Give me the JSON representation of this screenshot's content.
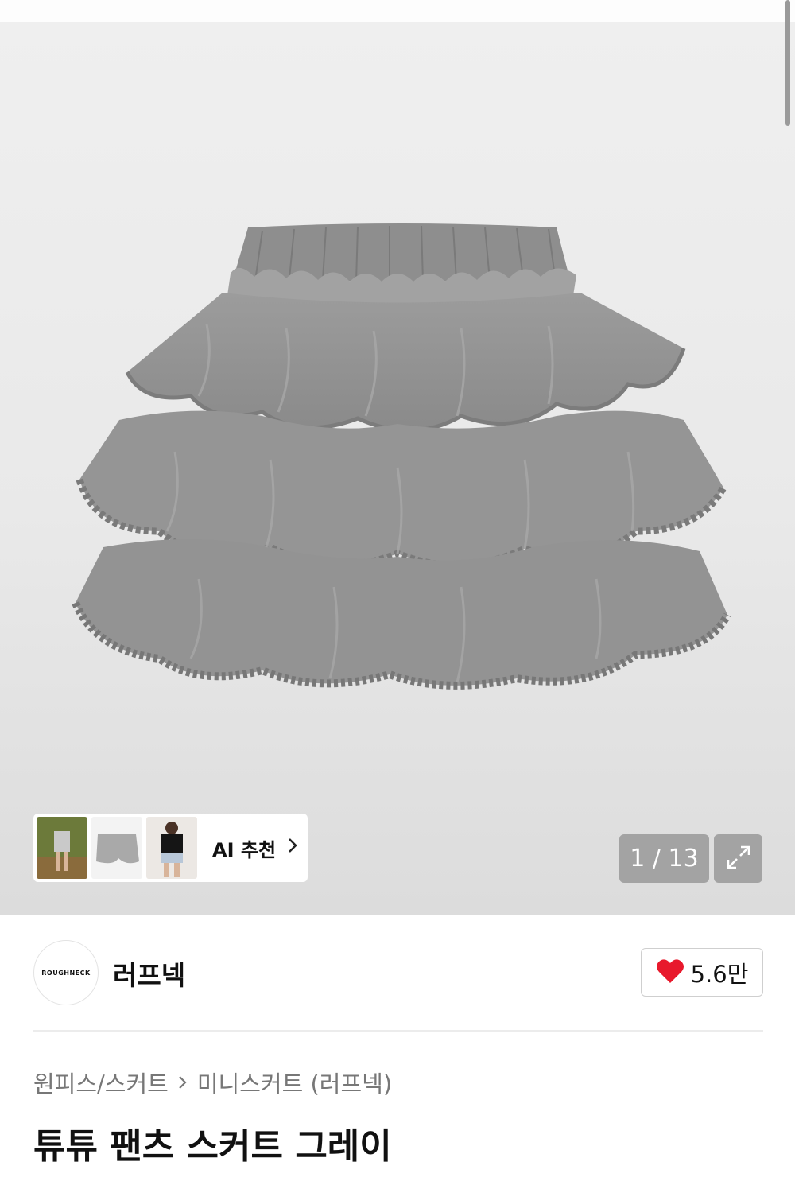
{
  "hero": {
    "ai_recommend_label": "AI 추천",
    "page_counter": "1 / 13"
  },
  "brand": {
    "logo_text": "ROUGHNECK",
    "name": "러프넥",
    "likes": "5.6만"
  },
  "breadcrumb": {
    "category": "원피스/스커트",
    "subcategory": "미니스커트 (러프넥)"
  },
  "product": {
    "title": "튜튜 팬츠 스커트 그레이"
  },
  "colors": {
    "like_heart": "#e8192c",
    "overlay": "#8c8c8c"
  },
  "icons": {
    "chevron": "chevron-right-icon",
    "expand": "expand-icon",
    "heart": "heart-icon"
  }
}
